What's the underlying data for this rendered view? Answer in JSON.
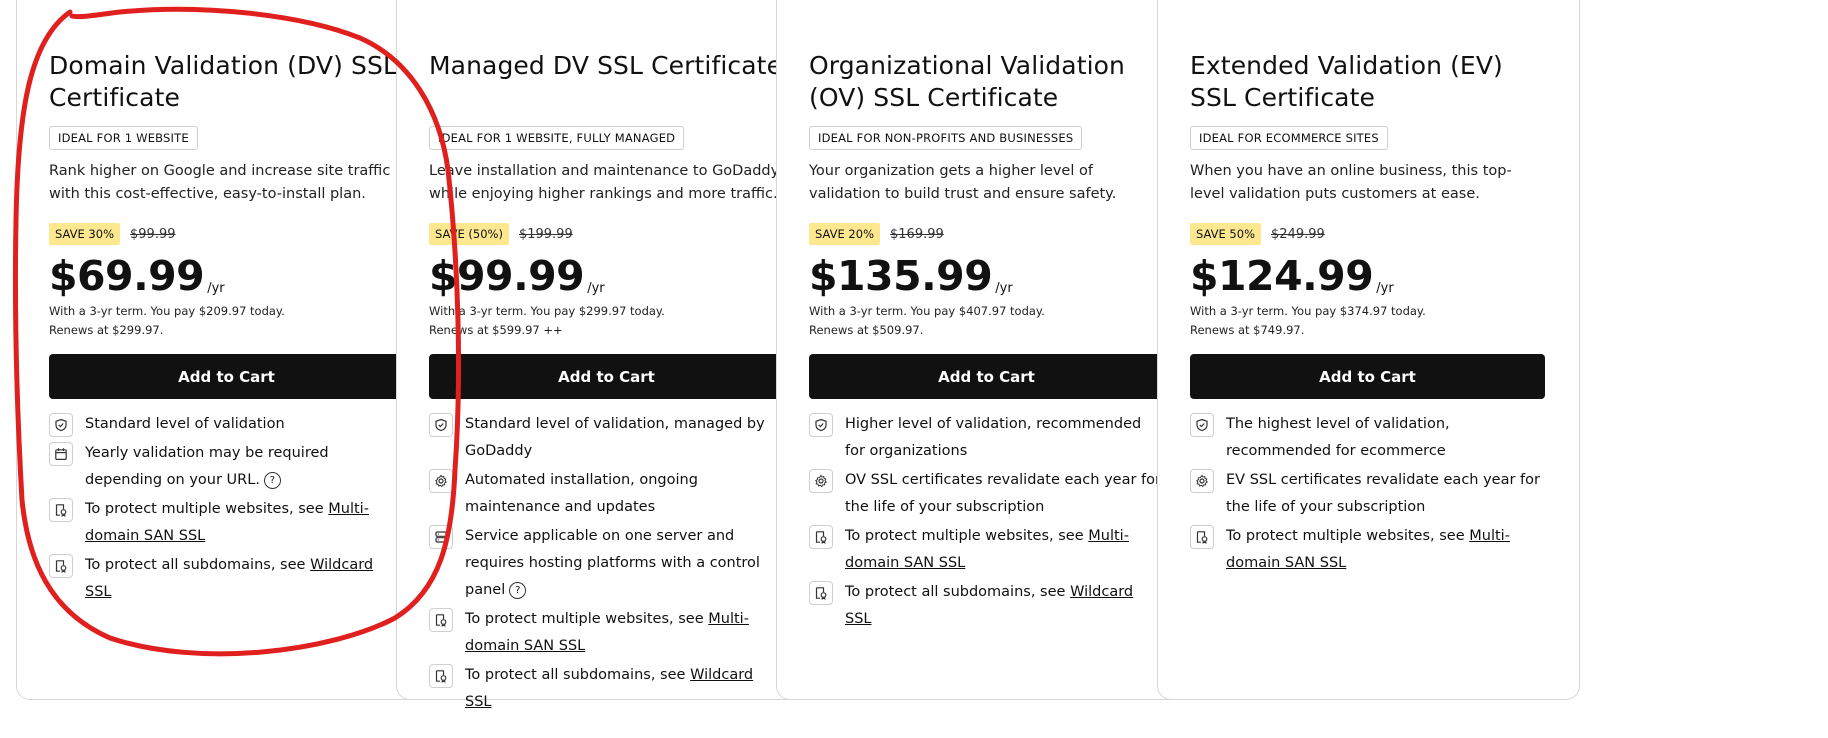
{
  "cards": [
    {
      "title": "Domain Validation (DV) SSL Certificate",
      "tag": "IDEAL FOR 1 WEBSITE",
      "description": "Rank higher on Google and increase site traffic with this cost-effective, easy-to-install plan.",
      "save": "SAVE 30%",
      "original_price": "$99.99",
      "price": "$69.99",
      "per": "/yr",
      "term": "With a 3-yr term. You pay $209.97 today.",
      "renews": "Renews at $299.97.",
      "cta": "Add to Cart",
      "features": [
        {
          "icon": "shield-check-icon",
          "text": "Standard level of validation",
          "link": "",
          "help": false
        },
        {
          "icon": "calendar-icon",
          "text": "Yearly validation may be required depending on your URL.",
          "link": "",
          "help": true
        },
        {
          "icon": "certificate-icon",
          "text": "To protect multiple websites, see ",
          "link": "Multi-domain SAN SSL",
          "help": false
        },
        {
          "icon": "certificate-icon",
          "text": "To protect all subdomains, see ",
          "link": "Wildcard SSL",
          "help": false
        }
      ]
    },
    {
      "title": "Managed DV SSL Certificate",
      "tag": "IDEAL FOR 1 WEBSITE, FULLY MANAGED",
      "description": "Leave installation and maintenance to GoDaddy, while enjoying higher rankings and more traffic.",
      "save": "SAVE (50%)",
      "original_price": "$199.99",
      "price": "$99.99",
      "per": "/yr",
      "term": "With a 3-yr term. You pay $299.97 today.",
      "renews": "Renews at $599.97 ++",
      "cta": "Add to Cart",
      "features": [
        {
          "icon": "shield-check-icon",
          "text": "Standard level of validation, managed by GoDaddy",
          "link": "",
          "help": false
        },
        {
          "icon": "gear-icon",
          "text": "Automated installation, ongoing maintenance and updates",
          "link": "",
          "help": false
        },
        {
          "icon": "server-icon",
          "text": "Service applicable on one server and requires hosting platforms with a control panel",
          "link": "",
          "help": true
        },
        {
          "icon": "certificate-icon",
          "text": "To protect multiple websites, see ",
          "link": "Multi-domain SAN SSL",
          "help": false
        },
        {
          "icon": "certificate-icon",
          "text": "To protect all subdomains, see ",
          "link": "Wildcard SSL",
          "help": false
        }
      ]
    },
    {
      "title": "Organizational Validation (OV) SSL Certificate",
      "tag": "IDEAL FOR NON-PROFITS AND BUSINESSES",
      "description": "Your organization gets a higher level of validation to build trust and ensure safety.",
      "save": "SAVE 20%",
      "original_price": "$169.99",
      "price": "$135.99",
      "per": "/yr",
      "term": "With a 3-yr term. You pay $407.97 today.",
      "renews": "Renews at $509.97.",
      "cta": "Add to Cart",
      "features": [
        {
          "icon": "shield-check-icon",
          "text": "Higher level of validation, recommended for organizations",
          "link": "",
          "help": false
        },
        {
          "icon": "gear-icon",
          "text": "OV SSL certificates revalidate each year for the life of your subscription",
          "link": "",
          "help": false
        },
        {
          "icon": "certificate-icon",
          "text": "To protect multiple websites, see ",
          "link": "Multi-domain SAN SSL",
          "help": false
        },
        {
          "icon": "certificate-icon",
          "text": "To protect all subdomains, see ",
          "link": "Wildcard SSL",
          "help": false
        }
      ]
    },
    {
      "title": "Extended Validation (EV) SSL Certificate",
      "tag": "IDEAL FOR ECOMMERCE SITES",
      "description": "When you have an online business, this top-level validation puts customers at ease.",
      "save": "SAVE 50%",
      "original_price": "$249.99",
      "price": "$124.99",
      "per": "/yr",
      "term": "With a 3-yr term. You pay $374.97 today.",
      "renews": "Renews at $749.97.",
      "cta": "Add to Cart",
      "features": [
        {
          "icon": "shield-check-icon",
          "text": "The highest level of validation, recommended for ecommerce",
          "link": "",
          "help": false
        },
        {
          "icon": "gear-icon",
          "text": "EV SSL certificates revalidate each year for the life of your subscription",
          "link": "",
          "help": false
        },
        {
          "icon": "certificate-icon",
          "text": "To protect multiple websites, see ",
          "link": "Multi-domain SAN SSL",
          "help": false
        }
      ]
    }
  ],
  "colors": {
    "cta_background": "#111111",
    "save_badge": "#fde88f",
    "annotation_marker": "#e0201e"
  }
}
